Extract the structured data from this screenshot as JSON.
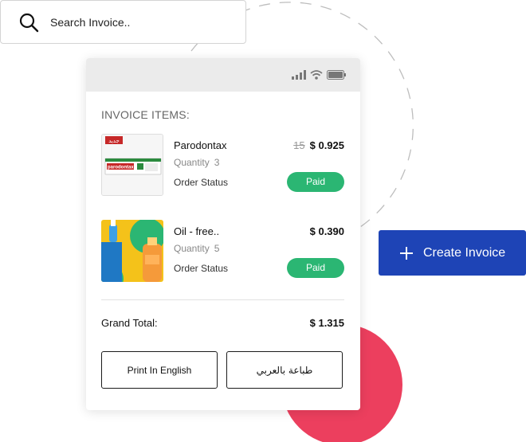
{
  "search": {
    "placeholder": "Search Invoice.."
  },
  "invoice": {
    "section_title": "INVOICE ITEMS:",
    "items": [
      {
        "name": "Parodontax",
        "old_price": "15",
        "price": "$ 0.925",
        "quantity_label": "Quantity",
        "quantity": "3",
        "status_label": "Order Status",
        "status": "Paid",
        "thumb_brand": "parodontax",
        "thumb_tag": "جديد"
      },
      {
        "name": "Oil - free..",
        "price": "$ 0.390",
        "quantity_label": "Quantity",
        "quantity": "5",
        "status_label": "Order Status",
        "status": "Paid"
      }
    ],
    "grand_total_label": "Grand Total:",
    "grand_total": "$ 1.315",
    "print_english_label": "Print In English",
    "print_arabic_label": "طباعة بالعربي"
  },
  "create_invoice": {
    "label": "Create Invoice"
  },
  "colors": {
    "accent_blue": "#1e44b6",
    "paid_green": "#2bb673",
    "decor_red": "#ec3f5e"
  },
  "icons": [
    "search-icon",
    "signal-icon",
    "wifi-icon",
    "battery-icon",
    "plus-icon"
  ]
}
